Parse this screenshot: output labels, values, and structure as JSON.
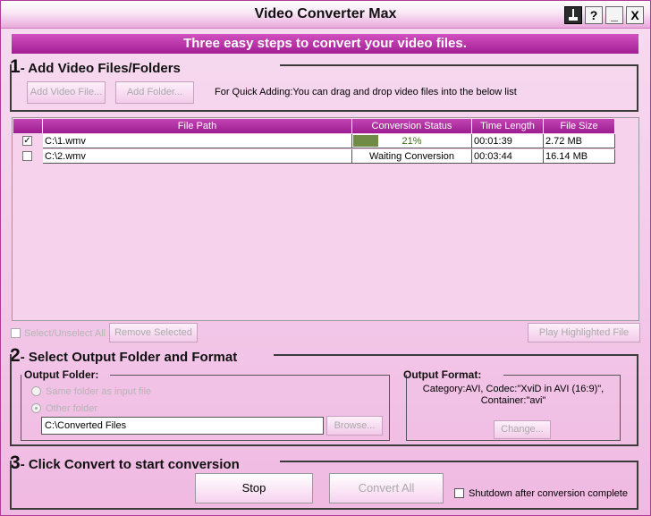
{
  "window": {
    "title": "Video Converter Max",
    "buttons": {
      "minimize": "_",
      "help": "?",
      "close": "X"
    }
  },
  "banner": "Three easy steps to convert your video files.",
  "step1": {
    "number": "1",
    "title": "- Add Video Files/Folders",
    "add_file_label": "Add Video File...",
    "add_folder_label": "Add Folder...",
    "hint": "For Quick Adding:You can drag and drop video files into the below list"
  },
  "file_list": {
    "columns": [
      "File Path",
      "Conversion Status",
      "Time Length",
      "File Size"
    ],
    "rows": [
      {
        "checked": true,
        "path": "C:\\1.wmv",
        "status": "21%",
        "progress": 0.21,
        "time": "00:01:39",
        "size": "2.72 MB"
      },
      {
        "checked": false,
        "path": "C:\\2.wmv",
        "status": "Waiting Conversion",
        "progress": 0,
        "time": "00:03:44",
        "size": "16.14 MB"
      }
    ],
    "select_all_label": "Select/Unselect All",
    "remove_selected_label": "Remove Selected",
    "play_highlighted_label": "Play Highlighted File"
  },
  "step2": {
    "number": "2",
    "title": "- Select Output Folder and Format",
    "output_folder_title": "Output Folder:",
    "same_folder_label": "Same folder as input file",
    "other_folder_label": "Other folder",
    "folder_path": "C:\\Converted Files",
    "browse_label": "Browse...",
    "output_format_title": "Output Format:",
    "format_line1": "Category:AVI, Codec:\"XviD in AVI (16:9)\",",
    "format_line2": "Container:\"avi\"",
    "change_label": "Change..."
  },
  "step3": {
    "number": "3",
    "title": "- Click Convert to start conversion",
    "stop_label": "Stop",
    "convert_all_label": "Convert All",
    "shutdown_label": "Shutdown after conversion complete"
  },
  "colors": {
    "progress_fill": "#6f8b45",
    "header_bg": "#a82299",
    "banner_bg": "#b532a6"
  }
}
